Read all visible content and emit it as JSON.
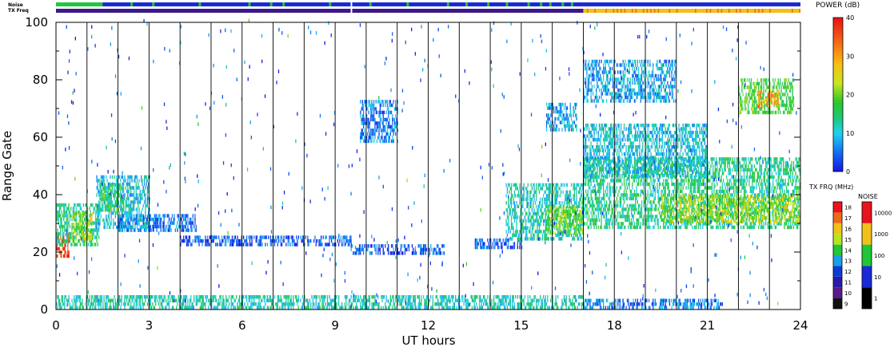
{
  "chart_data": [
    {
      "type": "heatmap",
      "title": "",
      "xlabel": "UT hours",
      "ylabel": "Range Gate",
      "xlim": [
        0,
        24
      ],
      "ylim": [
        0,
        100
      ],
      "x_ticks": [
        0,
        3,
        6,
        9,
        12,
        15,
        18,
        21,
        24
      ],
      "y_ticks": [
        0,
        20,
        40,
        60,
        80,
        100
      ],
      "vertical_lines_every_hours": 1,
      "colorbar": "POWER (dB)",
      "echo_regions": [
        {
          "t0": 0.0,
          "t1": 0.4,
          "g0": 18,
          "g1": 26,
          "power": 36
        },
        {
          "t0": 0.0,
          "t1": 1.4,
          "g0": 22,
          "g1": 36,
          "power": 14
        },
        {
          "t0": 0.5,
          "t1": 1.2,
          "g0": 24,
          "g1": 34,
          "power": 22
        },
        {
          "t0": 1.3,
          "t1": 3.0,
          "g0": 28,
          "g1": 46,
          "power": 10
        },
        {
          "t0": 1.4,
          "t1": 2.2,
          "g0": 34,
          "g1": 44,
          "power": 16
        },
        {
          "t0": 2.0,
          "t1": 4.5,
          "g0": 27,
          "g1": 33,
          "power": 6
        },
        {
          "t0": 4.0,
          "t1": 9.5,
          "g0": 22,
          "g1": 25,
          "power": 4
        },
        {
          "t0": 9.5,
          "t1": 12.5,
          "g0": 19,
          "g1": 22,
          "power": 4
        },
        {
          "t0": 13.5,
          "t1": 15.0,
          "g0": 21,
          "g1": 24,
          "power": 4
        },
        {
          "t0": 9.8,
          "t1": 11.0,
          "g0": 58,
          "g1": 72,
          "power": 6
        },
        {
          "t0": 14.5,
          "t1": 17.0,
          "g0": 24,
          "g1": 44,
          "power": 12
        },
        {
          "t0": 15.8,
          "t1": 17.0,
          "g0": 26,
          "g1": 36,
          "power": 20
        },
        {
          "t0": 15.8,
          "t1": 16.8,
          "g0": 62,
          "g1": 72,
          "power": 8
        },
        {
          "t0": 17.0,
          "t1": 24.0,
          "g0": 28,
          "g1": 52,
          "power": 14
        },
        {
          "t0": 19.5,
          "t1": 24.0,
          "g0": 30,
          "g1": 40,
          "power": 22
        },
        {
          "t0": 17.0,
          "t1": 21.0,
          "g0": 46,
          "g1": 64,
          "power": 10
        },
        {
          "t0": 17.0,
          "t1": 20.0,
          "g0": 72,
          "g1": 86,
          "power": 8
        },
        {
          "t0": 22.0,
          "t1": 23.8,
          "g0": 68,
          "g1": 80,
          "power": 18
        },
        {
          "t0": 22.6,
          "t1": 23.3,
          "g0": 70,
          "g1": 76,
          "power": 30
        },
        {
          "t0": 0.0,
          "t1": 17.0,
          "g0": 0,
          "g1": 5,
          "power": 12
        },
        {
          "t0": 17.0,
          "t1": 21.5,
          "g0": 0,
          "g1": 3,
          "power": 6
        }
      ]
    },
    {
      "type": "heatmap",
      "title": "POWER (dB)",
      "ticks": [
        0,
        10,
        20,
        30,
        40
      ],
      "range": [
        0,
        40
      ]
    },
    {
      "type": "heatmap",
      "title": "TX FRQ (MHz)",
      "ticks": [
        9,
        10,
        11,
        12,
        13,
        14,
        15,
        16,
        17,
        18
      ],
      "range": [
        9,
        18
      ],
      "colors": [
        "#111111",
        "#5a1a8a",
        "#2a1aa8",
        "#0d3bd6",
        "#1a9fe6",
        "#22c63a",
        "#b6e61a",
        "#f2c01a",
        "#ee6a18",
        "#e8141c"
      ]
    },
    {
      "type": "heatmap",
      "title": "NOISE",
      "ticks": [
        1,
        10,
        100,
        1000,
        10000
      ],
      "scale": "log",
      "colors": [
        "#000000",
        "#1a2ad6",
        "#22c63a",
        "#f2c01a",
        "#e8141c"
      ]
    }
  ],
  "top_strips": {
    "noise_label": "Noise",
    "txfreq_label": "TX Freq",
    "noise_segments": [
      {
        "t0": 0.0,
        "t1": 1.5,
        "color": "#22c63a"
      },
      {
        "t0": 1.5,
        "t1": 9.5,
        "color": "#1a2ad6"
      },
      {
        "t0": 9.5,
        "t1": 9.55,
        "color": "#ffffff"
      },
      {
        "t0": 9.55,
        "t1": 17.0,
        "color": "#1a2ad6"
      },
      {
        "t0": 17.0,
        "t1": 24.0,
        "color": "#1a2ad6"
      }
    ],
    "noise_flecks": [
      0.3,
      2.4,
      3.1,
      4.6,
      6.2,
      6.9,
      7.3,
      8.8,
      10.1,
      11.3,
      12.6,
      13.2,
      13.9,
      14.5,
      15.2,
      15.6,
      15.9,
      16.3,
      16.6
    ],
    "txfreq_segments": [
      {
        "t0": 0.0,
        "t1": 9.5,
        "color": "#3a1a8a"
      },
      {
        "t0": 9.55,
        "t1": 17.0,
        "color": "#3a1a8a"
      },
      {
        "t0": 17.0,
        "t1": 24.0,
        "color": "#f2c01a"
      }
    ]
  }
}
